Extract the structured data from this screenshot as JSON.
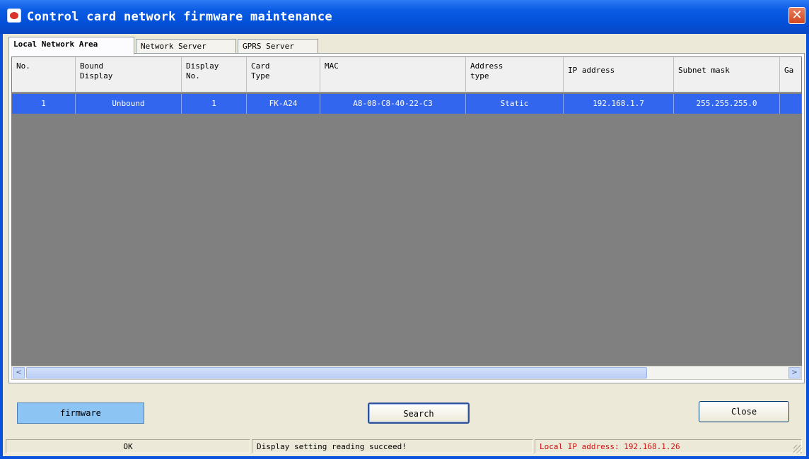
{
  "window": {
    "title": "Control card network firmware maintenance",
    "close_glyph": "✕",
    "icon": "app-icon"
  },
  "tabs": [
    {
      "label": "Local Network Area",
      "active": true
    },
    {
      "label": "Network Server",
      "active": false
    },
    {
      "label": "GPRS Server",
      "active": false
    }
  ],
  "table": {
    "columns": [
      "No.",
      "Bound\nDisplay",
      "Display\nNo.",
      "Card\nType",
      "MAC",
      "Address\ntype",
      "IP address",
      "Subnet mask",
      "Ga"
    ],
    "rows": [
      [
        "1",
        "Unbound",
        "1",
        "FK-A24",
        "A8-08-C8-40-22-C3",
        "Static",
        "192.168.1.7",
        "255.255.255.0",
        ""
      ]
    ],
    "selected_row": 0,
    "row_color": "#3366ee",
    "empty_bg": "#808080"
  },
  "scrollbar": {
    "left_arrow": "<",
    "right_arrow": ">"
  },
  "buttons": {
    "firmware": "firmware",
    "search": "Search",
    "close": "Close"
  },
  "status": {
    "state": "OK",
    "message": "Display setting reading succeed!",
    "local_ip": "Local IP address: 192.168.1.26",
    "local_ip_color": "#cc1111"
  }
}
